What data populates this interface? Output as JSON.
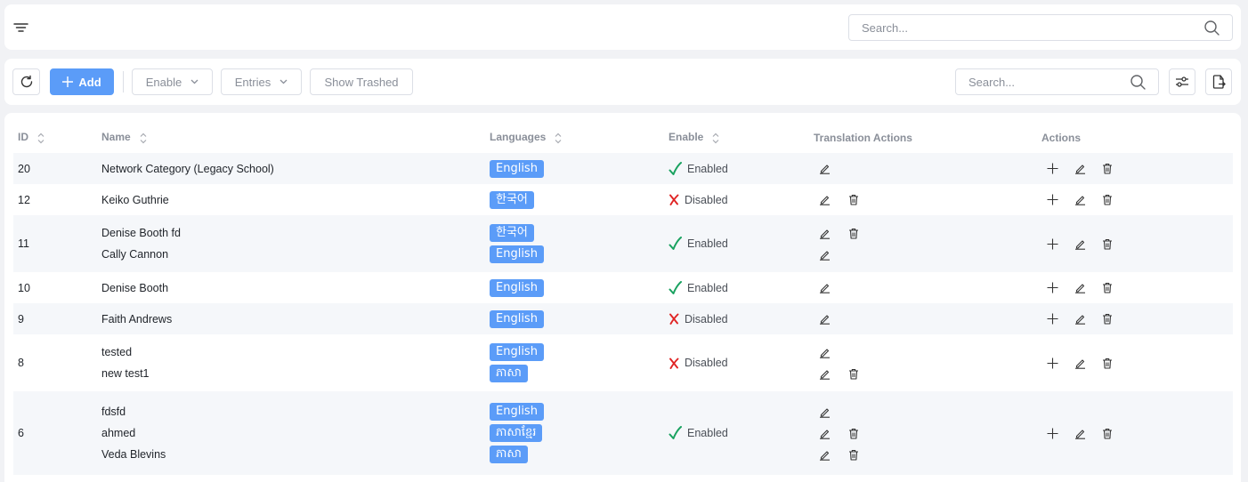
{
  "top_bar": {
    "search_placeholder": "Search..."
  },
  "toolbar": {
    "add_label": "Add",
    "enable_label": "Enable",
    "entries_label": "Entries",
    "show_trashed_label": "Show Trashed",
    "search_placeholder": "Search..."
  },
  "table": {
    "headers": {
      "id": "ID",
      "name": "Name",
      "languages": "Languages",
      "enable": "Enable",
      "translation_actions": "Translation Actions",
      "actions": "Actions"
    },
    "rows": [
      {
        "id": "20",
        "names": [
          "Network Category (Legacy School)"
        ],
        "langs": [
          "English"
        ],
        "status": "Enabled",
        "trans": [
          false
        ]
      },
      {
        "id": "12",
        "names": [
          "Keiko Guthrie"
        ],
        "langs": [
          "한국어"
        ],
        "status": "Disabled",
        "trans": [
          true
        ]
      },
      {
        "id": "11",
        "names": [
          "Denise Booth fd",
          "Cally Cannon"
        ],
        "langs": [
          "한국어",
          "English"
        ],
        "status": "Enabled",
        "trans": [
          true,
          false
        ]
      },
      {
        "id": "10",
        "names": [
          "Denise Booth"
        ],
        "langs": [
          "English"
        ],
        "status": "Enabled",
        "trans": [
          false
        ]
      },
      {
        "id": "9",
        "names": [
          "Faith Andrews"
        ],
        "langs": [
          "English"
        ],
        "status": "Disabled",
        "trans": [
          false
        ]
      },
      {
        "id": "8",
        "names": [
          "tested",
          "new test1"
        ],
        "langs": [
          "English",
          "ភាសា"
        ],
        "status": "Disabled",
        "trans": [
          false,
          true
        ]
      },
      {
        "id": "6",
        "names": [
          "fdsfd",
          "ahmed",
          "Veda Blevins"
        ],
        "langs": [
          "English",
          "ភាសាខ្មែរ",
          "ភាសា"
        ],
        "status": "Enabled",
        "trans": [
          false,
          true,
          true
        ]
      }
    ]
  },
  "colors": {
    "primary": "#5b9cf8",
    "enabled": "#1aa260",
    "disabled": "#e02424",
    "striped": "#f5f7fa"
  }
}
